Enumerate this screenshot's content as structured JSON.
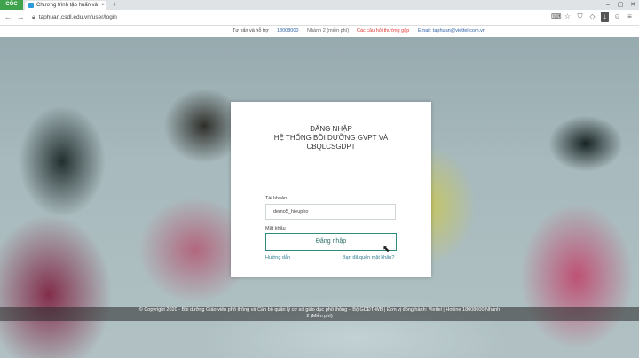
{
  "browser": {
    "brand": "CỐC CỐC",
    "tab_title": "Chương trình tập huấn và bồi",
    "url": "taphuan.csdl.edu.vn/user/login"
  },
  "infobar": {
    "support_label": "Tư vấn và hỗ trợ",
    "phone": "18008000",
    "branch": "Nhánh 2 (miễn phí)",
    "faq": "Các câu hỏi thường gặp",
    "email": "Email: taphuan@viettel.com.vn"
  },
  "login": {
    "title_line1": "ĐĂNG NHẬP",
    "title_line2": "HỆ THỐNG BỒI DƯỠNG GVPT VÀ",
    "title_line3": "CBQLCSGDPT",
    "username_label": "Tài khoản",
    "username_value": "demo5_hieupho",
    "password_label": "Mật khẩu",
    "password_value": "•••",
    "guide_link": "Hướng dẫn",
    "forgot_link": "Bạn đã quên mật khẩu?",
    "submit_label": "Đăng nhập"
  },
  "footer": {
    "line1": "© Copyright 2020 - Bồi dưỡng Giáo viên phổ thông và Cán bộ quản lý cơ sở giáo dục phổ thông – Bộ GDĐT-WB | Đơn vị đồng hành: Viettel | Hotline 18008000 Nhánh",
    "line2": "2 (Miễn phí)"
  },
  "colors": {
    "accent": "#2e8b7e",
    "brand_green": "#3fa34d",
    "infobar_phone": "#2b5fa8",
    "infobar_faq": "#e53935"
  }
}
